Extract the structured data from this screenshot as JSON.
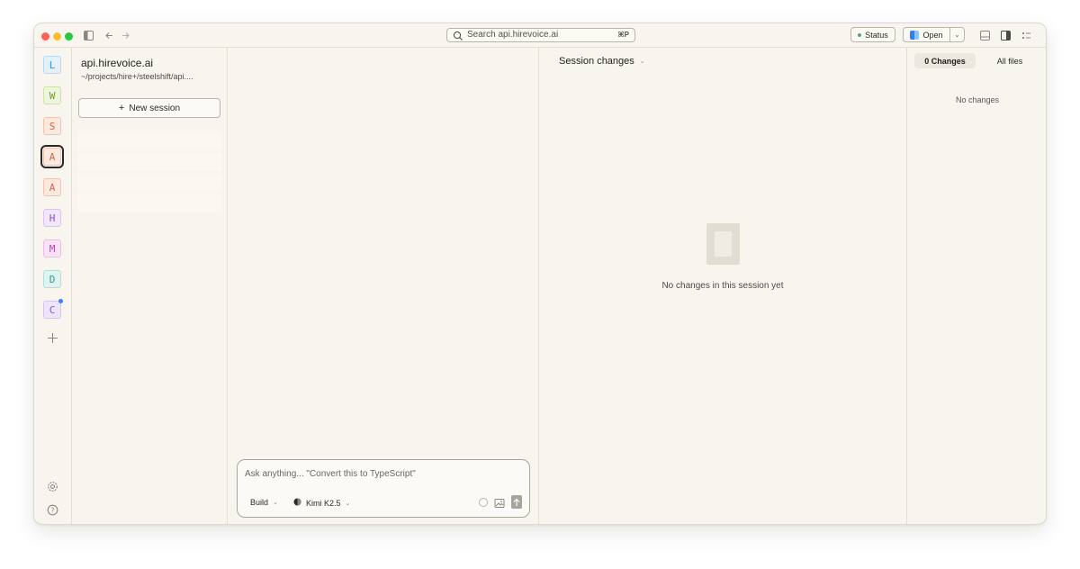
{
  "titlebar": {
    "search_placeholder": "Search api.hirevoice.ai",
    "search_shortcut": "⌘P",
    "status_label": "Status",
    "open_label": "Open"
  },
  "rail": {
    "projects": [
      {
        "letter": "L",
        "color": "#3b8fd6",
        "bg": "#e4f1fb",
        "border": "#b8d9f2"
      },
      {
        "letter": "W",
        "color": "#6f9a2c",
        "bg": "#eef5dd",
        "border": "#cfe3a8"
      },
      {
        "letter": "S",
        "color": "#d9623b",
        "bg": "#fbe8df",
        "border": "#f1c4b0"
      },
      {
        "letter": "A",
        "color": "#d9623b",
        "bg": "#fbe8df",
        "border": "#f1c4b0",
        "active": true
      },
      {
        "letter": "A",
        "color": "#d9623b",
        "bg": "#fbe8df",
        "border": "#f1c4b0"
      },
      {
        "letter": "H",
        "color": "#8b4fc8",
        "bg": "#f1e6fa",
        "border": "#dbc4f0"
      },
      {
        "letter": "M",
        "color": "#b43fb0",
        "bg": "#f7e3f5",
        "border": "#e9bde5"
      },
      {
        "letter": "D",
        "color": "#2f9d8c",
        "bg": "#dff3ef",
        "border": "#b2e0d7"
      },
      {
        "letter": "C",
        "color": "#7b58c9",
        "bg": "#ede6fa",
        "border": "#d3c6f1",
        "notification": true
      }
    ]
  },
  "sessions": {
    "project_name": "api.hirevoice.ai",
    "project_path": "~/projects/hire+/steelshift/api....",
    "new_session_label": "New session"
  },
  "composer": {
    "placeholder": "Ask anything... \"Convert this to TypeScript\"",
    "mode": "Build",
    "model": "Kimi K2.5"
  },
  "review": {
    "title": "Session changes",
    "empty_text": "No changes in this session yet"
  },
  "files": {
    "tab_changes": "0 Changes",
    "tab_all": "All files",
    "empty_text": "No changes"
  }
}
